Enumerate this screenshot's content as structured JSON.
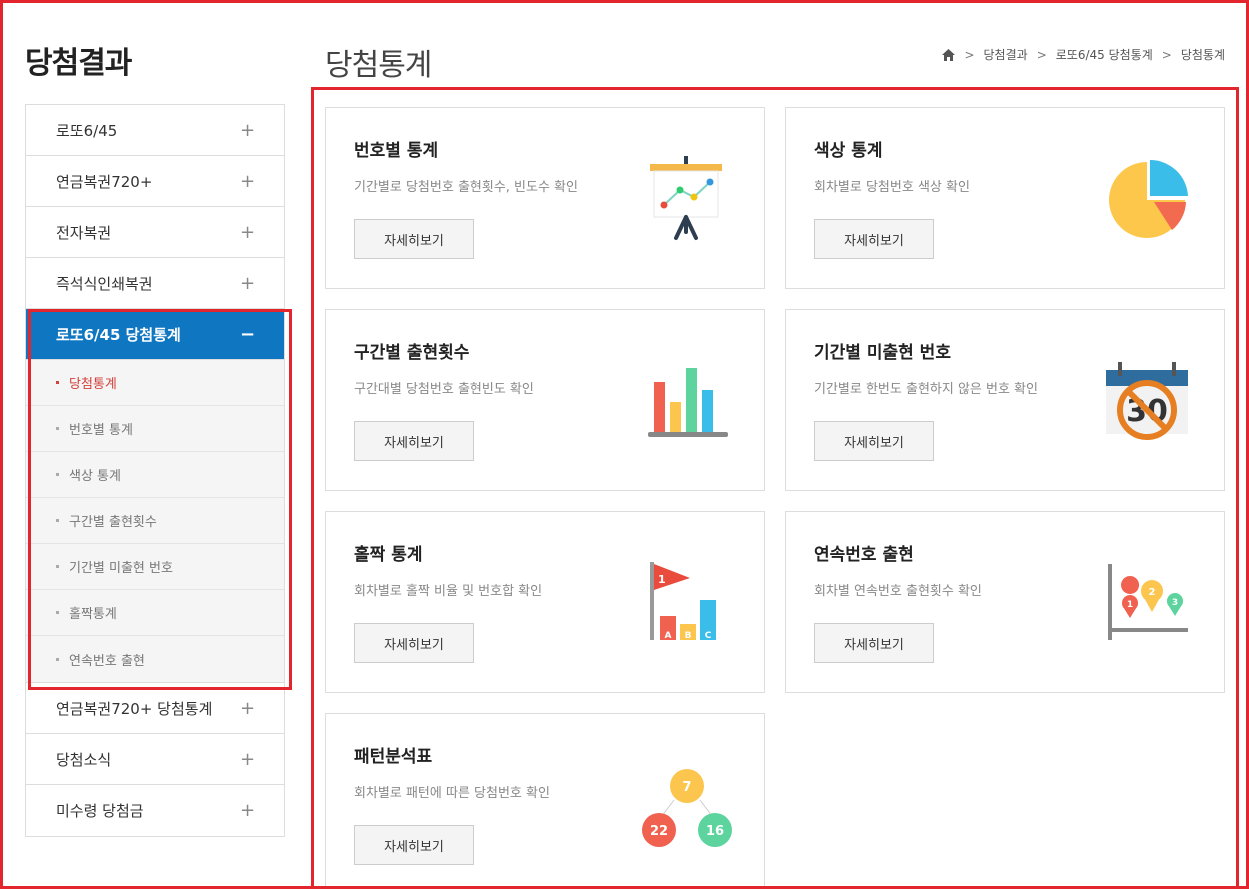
{
  "sidebar": {
    "title": "당첨결과",
    "items": [
      {
        "label": "로또6/45",
        "sign": "+"
      },
      {
        "label": "연금복권720+",
        "sign": "+"
      },
      {
        "label": "전자복권",
        "sign": "+"
      },
      {
        "label": "즉석식인쇄복권",
        "sign": "+"
      },
      {
        "label": "로또6/45 당첨통계",
        "sign": "−"
      },
      {
        "label": "연금복권720+ 당첨통계",
        "sign": "+"
      },
      {
        "label": "당첨소식",
        "sign": "+"
      },
      {
        "label": "미수령 당첨금",
        "sign": "+"
      }
    ],
    "submenu": [
      "당첨통계",
      "번호별 통계",
      "색상 통계",
      "구간별 출현횟수",
      "기간별 미출현 번호",
      "홀짝통계",
      "연속번호 출현"
    ]
  },
  "header": {
    "title": "당첨통계",
    "breadcrumb": [
      "당첨결과",
      "로또6/45 당첨통계",
      "당첨통계"
    ]
  },
  "cards": [
    {
      "title": "번호별 통계",
      "desc": "기간별로 당첨번호 출현횟수, 빈도수 확인",
      "button": "자세히보기"
    },
    {
      "title": "색상 통계",
      "desc": "회차별로 당첨번호 색상 확인",
      "button": "자세히보기"
    },
    {
      "title": "구간별 출현횟수",
      "desc": "구간대별 당첨번호 출현빈도 확인",
      "button": "자세히보기"
    },
    {
      "title": "기간별 미출현 번호",
      "desc": "기간별로 한번도 출현하지 않은 번호 확인",
      "button": "자세히보기"
    },
    {
      "title": "홀짝 통계",
      "desc": "회차별로 홀짝 비율 및 번호합 확인",
      "button": "자세히보기"
    },
    {
      "title": "연속번호 출현",
      "desc": "회차별 연속번호 출현횟수 확인",
      "button": "자세히보기"
    },
    {
      "title": "패턴분석표",
      "desc": "회차별로 패턴에 따른 당첨번호 확인",
      "button": "자세히보기"
    }
  ],
  "illustrations": {
    "calendar_number": "30",
    "flag_number": "1",
    "bar_letters": [
      "A",
      "B",
      "C"
    ],
    "pins": [
      "1",
      "2",
      "3"
    ],
    "balls": [
      "7",
      "22",
      "16"
    ]
  },
  "colors": {
    "accent": "#0f76c1",
    "highlight": "#e3252e",
    "current": "#d2413a"
  }
}
